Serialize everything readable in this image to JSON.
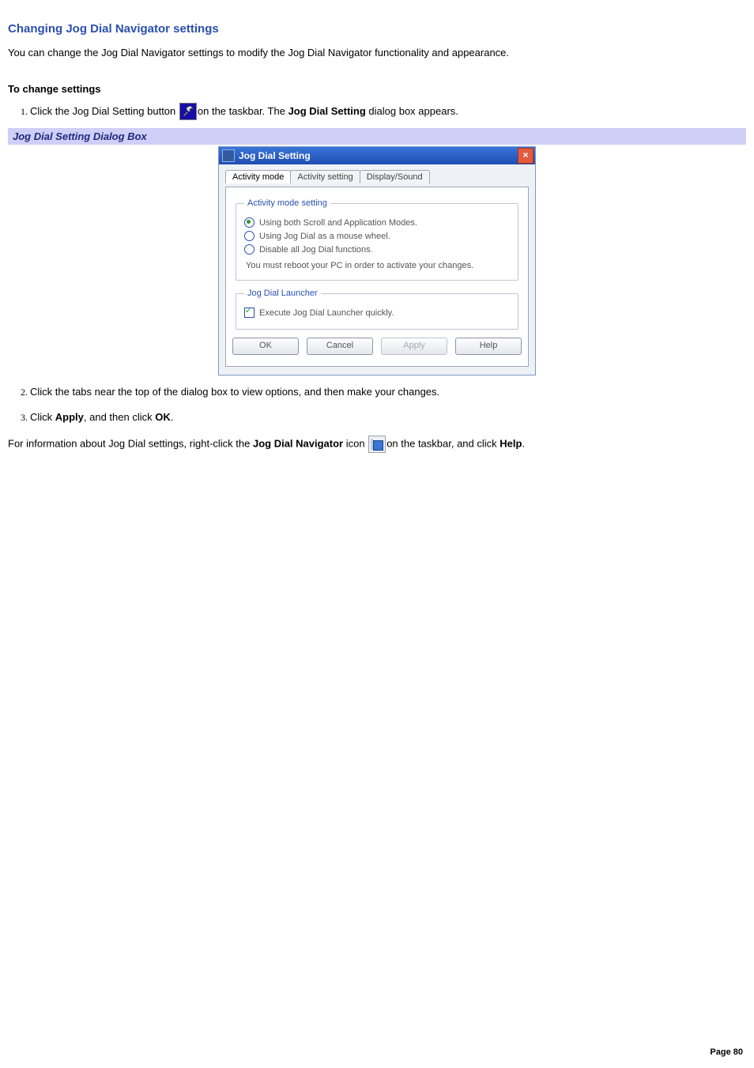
{
  "title": "Changing Jog Dial Navigator settings",
  "intro": "You can change the Jog Dial Navigator settings to modify the Jog Dial Navigator functionality and appearance.",
  "subhead": "To change settings",
  "step1_a": "Click the Jog Dial Setting button ",
  "step1_b": "on the taskbar. The ",
  "step1_bold": "Jog Dial Setting",
  "step1_c": " dialog box appears.",
  "caption": "Jog Dial Setting Dialog Box",
  "dialog": {
    "title": "Jog Dial Setting",
    "tabs": {
      "t1": "Activity mode",
      "t2": "Activity setting",
      "t3": "Display/Sound"
    },
    "fs1_legend": "Activity mode setting",
    "opt1": "Using both Scroll and Application Modes.",
    "opt2": "Using Jog Dial as a mouse wheel.",
    "opt3": "Disable all Jog Dial functions.",
    "hint": "You must reboot your PC in order to activate your changes.",
    "fs2_legend": "Jog Dial Launcher",
    "chk1": "Execute Jog Dial Launcher quickly.",
    "buttons": {
      "ok": "OK",
      "cancel": "Cancel",
      "apply": "Apply",
      "help": "Help"
    }
  },
  "step2": "Click the tabs near the top of the dialog box to view options, and then make your changes.",
  "step3_a": "Click ",
  "step3_b1": "Apply",
  "step3_mid": ", and then click ",
  "step3_b2": "OK",
  "step3_end": ".",
  "final_a": "For information about Jog Dial settings, right-click the ",
  "final_b1": "Jog Dial Navigator",
  "final_mid": " icon ",
  "final_c": "on the taskbar, and click ",
  "final_b2": "Help",
  "final_end": ".",
  "page_num": "Page 80"
}
